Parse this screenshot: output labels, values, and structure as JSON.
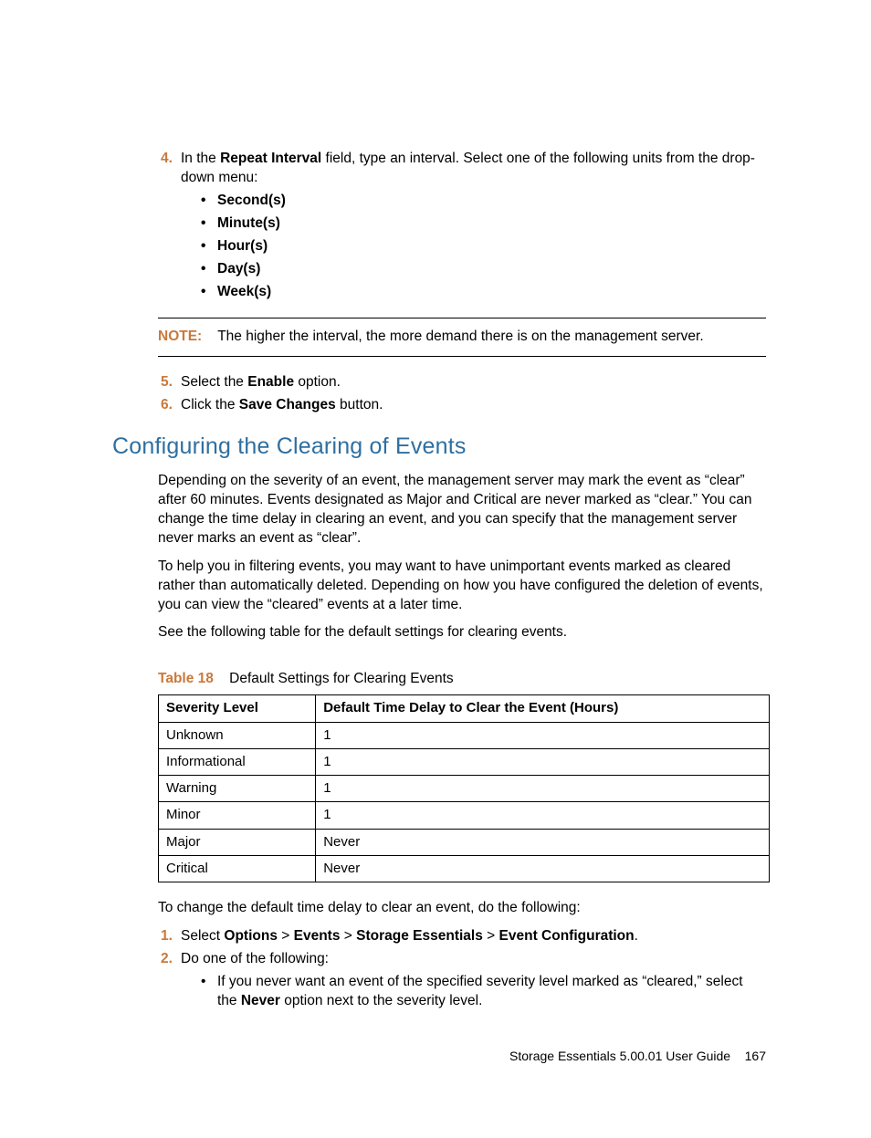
{
  "step4": {
    "num": "4.",
    "pre": "In the ",
    "bold1": "Repeat Interval",
    "post": " field, type an interval. Select one of the following units from the drop-down menu:",
    "opts": [
      "Second(s)",
      "Minute(s)",
      "Hour(s)",
      "Day(s)",
      "Week(s)"
    ]
  },
  "note": {
    "label": "NOTE:",
    "text": "The higher the interval, the more demand there is on the management server."
  },
  "step5": {
    "num": "5.",
    "pre": "Select the ",
    "bold": "Enable",
    "post": " option."
  },
  "step6": {
    "num": "6.",
    "pre": "Click the ",
    "bold": "Save Changes",
    "post": " button."
  },
  "heading": "Configuring the Clearing of Events",
  "para1": "Depending on the severity of an event, the management server may mark the event as “clear” after 60 minutes. Events designated as Major and Critical are never marked as “clear.” You can change the time delay in clearing an event, and you can specify that the management server never marks an event as “clear”.",
  "para2": "To help you in filtering events, you may want to have unimportant events marked as cleared rather than automatically deleted. Depending on how you have configured the deletion of events, you can view the “cleared” events at a later time.",
  "para3": "See the following table for the default settings for clearing events.",
  "tablecap": {
    "label": "Table 18",
    "text": "Default Settings for Clearing Events"
  },
  "table": {
    "headers": [
      "Severity Level",
      "Default Time Delay to Clear the Event (Hours)"
    ],
    "rows": [
      [
        "Unknown",
        "1"
      ],
      [
        "Informational",
        "1"
      ],
      [
        "Warning",
        "1"
      ],
      [
        "Minor",
        "1"
      ],
      [
        "Major",
        "Never"
      ],
      [
        "Critical",
        "Never"
      ]
    ]
  },
  "para4": "To change the default time delay to clear an event, do the following:",
  "s1": {
    "num": "1.",
    "pre": "Select ",
    "b1": "Options",
    "g1": " > ",
    "b2": "Events",
    "g2": " > ",
    "b3": "Storage Essentials",
    "g3": " > ",
    "b4": "Event Configuration",
    "post": "."
  },
  "s2": {
    "num": "2.",
    "text": "Do one of the following:"
  },
  "s2a": {
    "pre": "If you never want an event of the specified severity level marked as “cleared,” select the ",
    "bold": "Never",
    "post": " option next to the severity level."
  },
  "footer": {
    "title": "Storage Essentials 5.00.01 User Guide",
    "page": "167"
  }
}
